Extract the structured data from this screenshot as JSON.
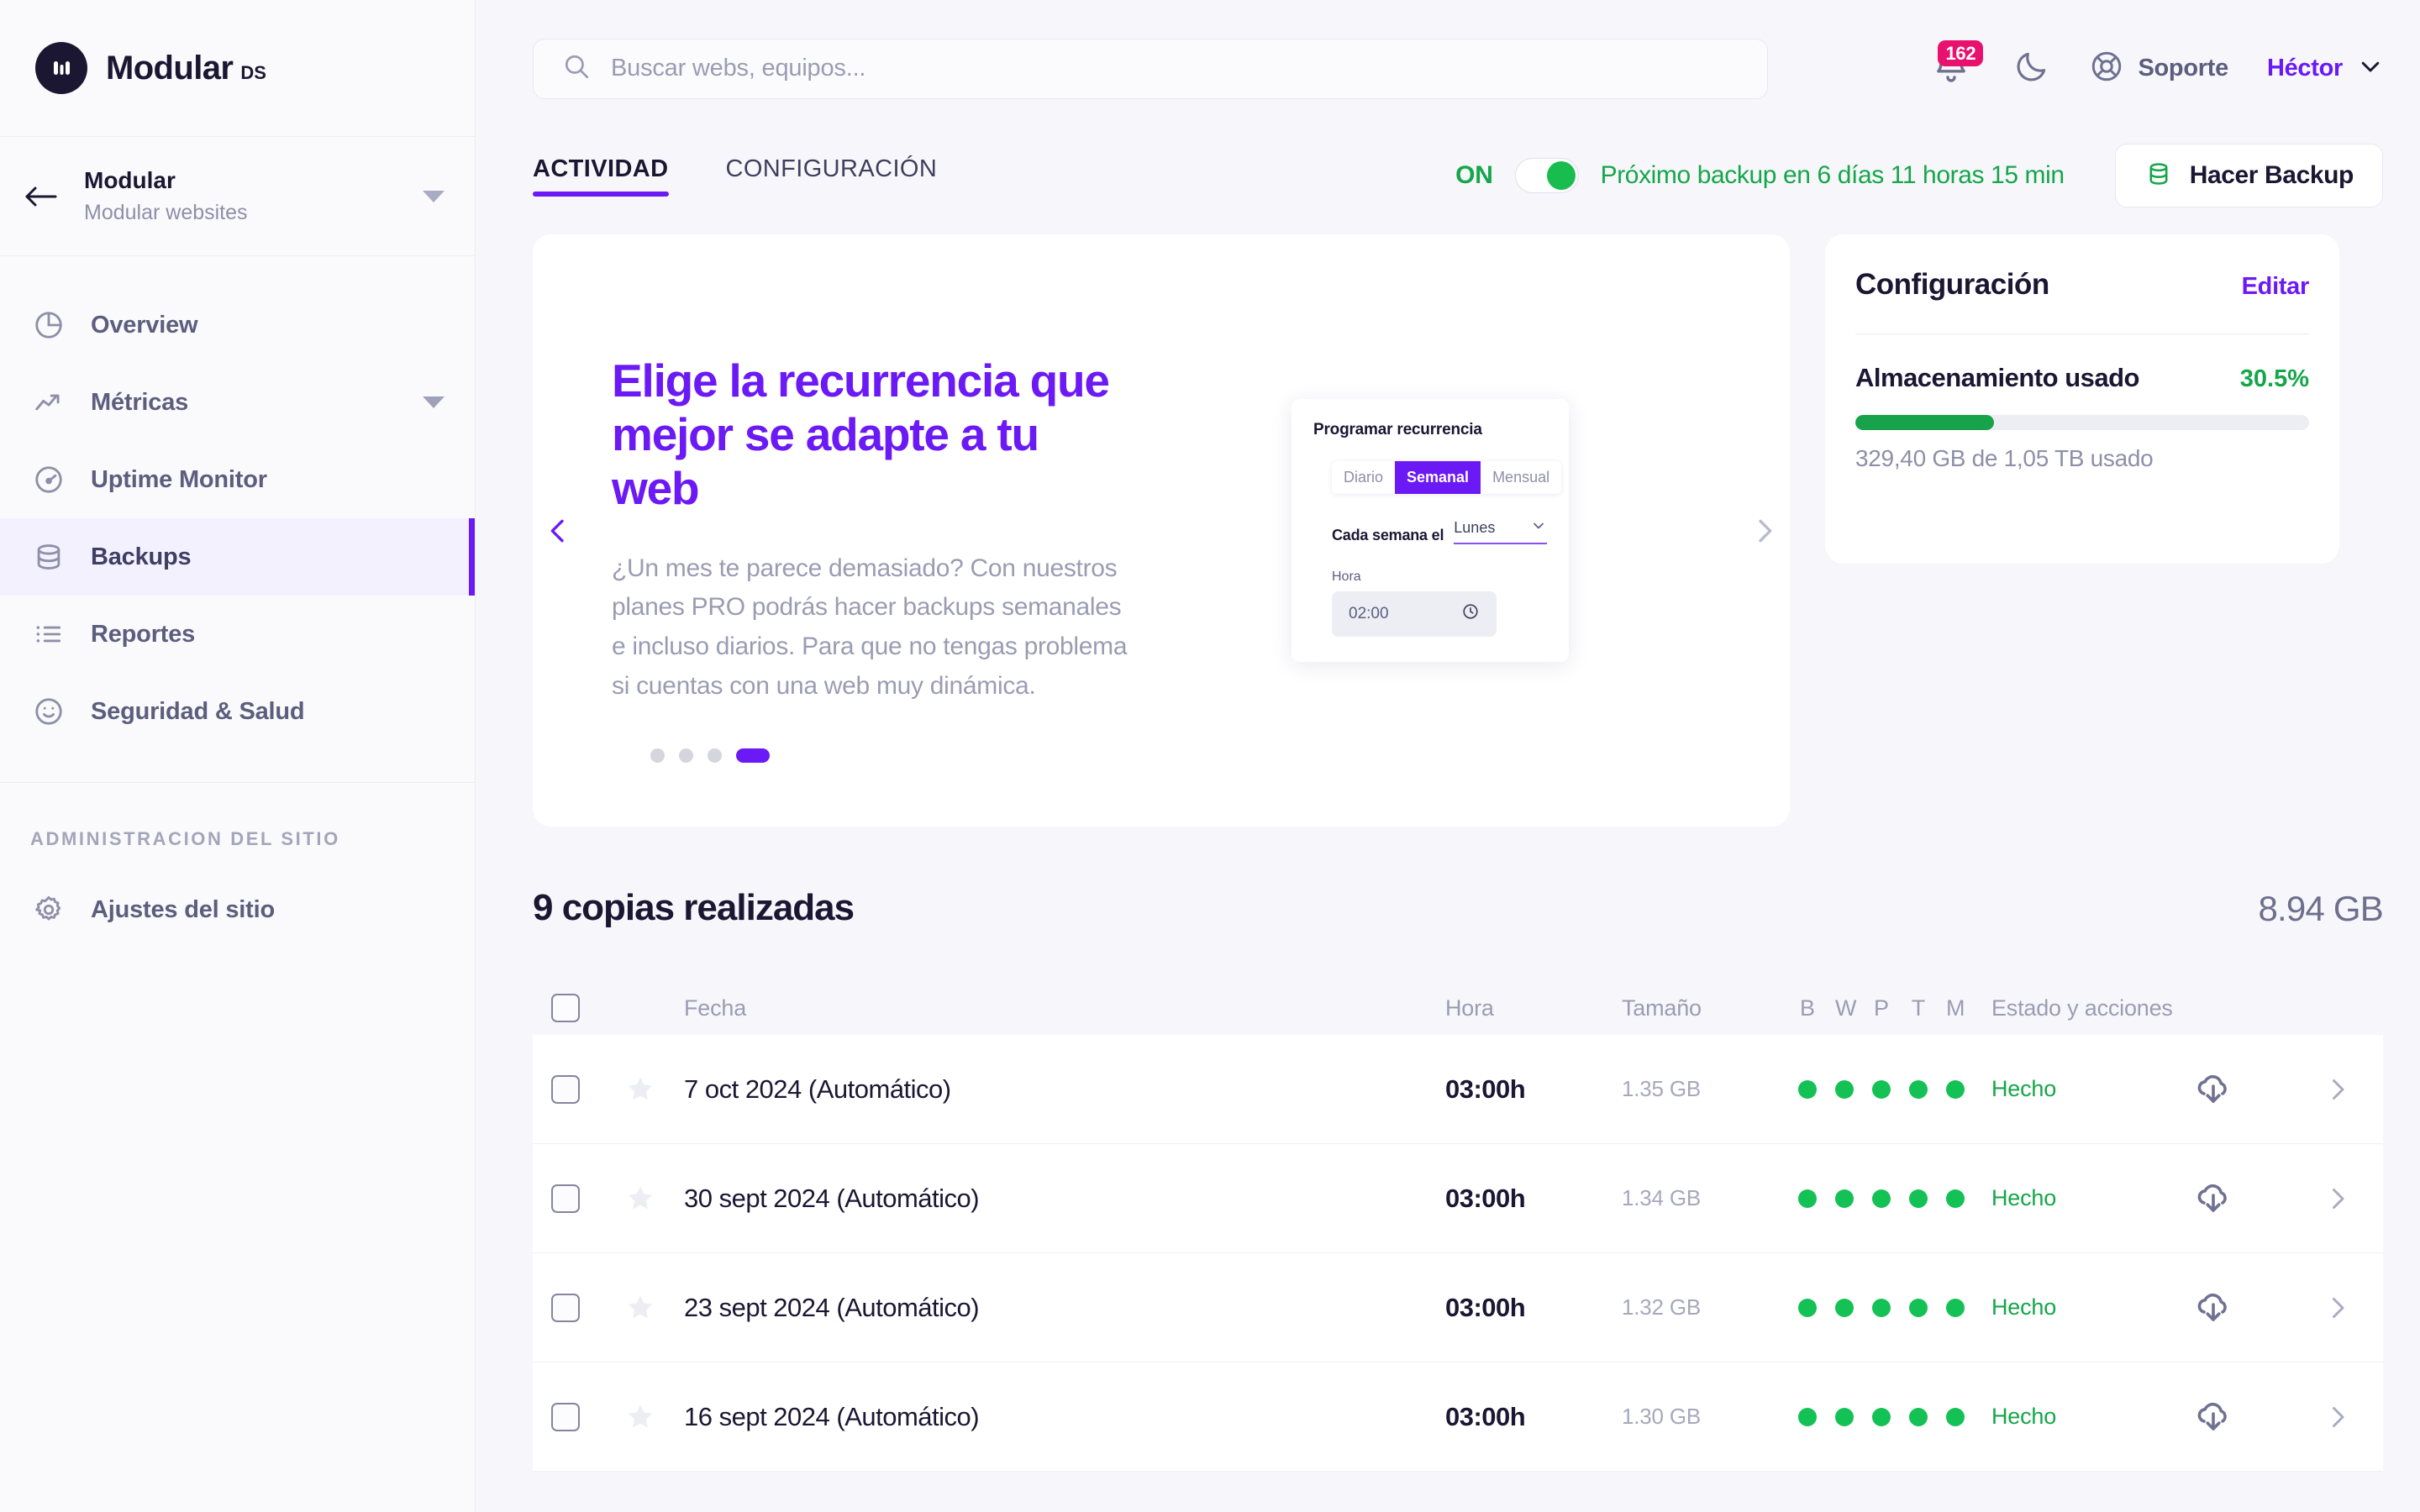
{
  "brand": {
    "name": "Modular",
    "suffix": "DS",
    "logo_icon": "modular-logo-icon"
  },
  "site_switcher": {
    "back_icon": "arrow-left-icon",
    "title": "Modular",
    "subtitle": "Modular websites",
    "caret_icon": "caret-down-icon"
  },
  "sidebar": {
    "items": [
      {
        "label": "Overview",
        "icon": "pie-chart-icon",
        "active": false,
        "has_caret": false
      },
      {
        "label": "Métricas",
        "icon": "trending-up-icon",
        "active": false,
        "has_caret": true
      },
      {
        "label": "Uptime Monitor",
        "icon": "gauge-icon",
        "active": false,
        "has_caret": false
      },
      {
        "label": "Backups",
        "icon": "database-icon",
        "active": true,
        "has_caret": false
      },
      {
        "label": "Reportes",
        "icon": "list-icon",
        "active": false,
        "has_caret": false
      },
      {
        "label": "Seguridad & Salud",
        "icon": "smiley-icon",
        "active": false,
        "has_caret": false
      }
    ],
    "admin_section_title": "ADMINISTRACION DEL SITIO",
    "admin_items": [
      {
        "label": "Ajustes del sitio",
        "icon": "gear-icon"
      }
    ]
  },
  "topbar": {
    "search_placeholder": "Buscar webs, equipos...",
    "search_value": "",
    "search_icon": "search-icon",
    "notifications_count": "162",
    "bell_icon": "bell-icon",
    "theme_icon": "moon-icon",
    "support_icon": "lifebuoy-icon",
    "support_label": "Soporte",
    "user_name": "Héctor",
    "user_caret_icon": "chevron-down-icon"
  },
  "tabs": [
    {
      "label": "ACTIVIDAD",
      "active": true
    },
    {
      "label": "CONFIGURACIÓN",
      "active": false
    }
  ],
  "backup_bar": {
    "toggle_label": "ON",
    "toggle_on": true,
    "next_backup_text": "Próximo backup en 6 días 11 horas 15 min",
    "button_label": "Hacer Backup",
    "button_icon": "database-icon"
  },
  "promo": {
    "prev_icon": "chevron-left-icon",
    "next_icon": "chevron-right-icon",
    "title": "Elige la recurrencia que mejor se adapte a tu web",
    "description": "¿Un mes te parece demasiado? Con nuestros planes PRO podrás hacer backups semanales e incluso diarios. Para que no tengas problema si cuentas con una web muy dinámica.",
    "widget": {
      "title": "Programar recurrencia",
      "segments": [
        "Diario",
        "Semanal",
        "Mensual"
      ],
      "segment_selected": "Semanal",
      "day_label": "Cada semana el",
      "day_value": "Lunes",
      "day_caret_icon": "chevron-down-icon",
      "time_label": "Hora",
      "time_value": "02:00",
      "time_icon": "clock-icon"
    },
    "dots_total": 4,
    "dots_active_index": 3
  },
  "config_card": {
    "title": "Configuración",
    "edit_label": "Editar",
    "storage_title": "Almacenamiento usado",
    "storage_percent_label": "30.5%",
    "storage_percent_value": 30.5,
    "storage_note": "329,40 GB de 1,05 TB usado",
    "accent_green": "#18a249"
  },
  "table": {
    "title": "9 copias realizadas",
    "total_size": "8.94 GB",
    "select_all_checked": false,
    "columns": {
      "date": "Fecha",
      "hora": "Hora",
      "size": "Tamaño",
      "flags": [
        "B",
        "W",
        "P",
        "T",
        "M"
      ],
      "state": "Estado y acciones"
    },
    "rows": [
      {
        "date": "7 oct 2024 (Automático)",
        "hora": "03:00h",
        "size": "1.35 GB",
        "flags": [
          true,
          true,
          true,
          true,
          true
        ],
        "state": "Hecho",
        "download_icon": "cloud-download-icon",
        "detail_icon": "chevron-right-icon",
        "star_icon": "star-icon",
        "checked": false
      },
      {
        "date": "30 sept 2024 (Automático)",
        "hora": "03:00h",
        "size": "1.34 GB",
        "flags": [
          true,
          true,
          true,
          true,
          true
        ],
        "state": "Hecho",
        "download_icon": "cloud-download-icon",
        "detail_icon": "chevron-right-icon",
        "star_icon": "star-icon",
        "checked": false
      },
      {
        "date": "23 sept 2024 (Automático)",
        "hora": "03:00h",
        "size": "1.32 GB",
        "flags": [
          true,
          true,
          true,
          true,
          true
        ],
        "state": "Hecho",
        "download_icon": "cloud-download-icon",
        "detail_icon": "chevron-right-icon",
        "star_icon": "star-icon",
        "checked": false
      },
      {
        "date": "16 sept 2024 (Automático)",
        "hora": "03:00h",
        "size": "1.30 GB",
        "flags": [
          true,
          true,
          true,
          true,
          true
        ],
        "state": "Hecho",
        "download_icon": "cloud-download-icon",
        "detail_icon": "chevron-right-icon",
        "star_icon": "star-icon",
        "checked": false
      }
    ]
  },
  "colors": {
    "accent_purple": "#6b19f5",
    "green": "#15a64a",
    "dot_green": "#14c154",
    "badge_pink": "#e8116d",
    "page_bg": "#f7f7fb",
    "ink": "#1b1733"
  }
}
